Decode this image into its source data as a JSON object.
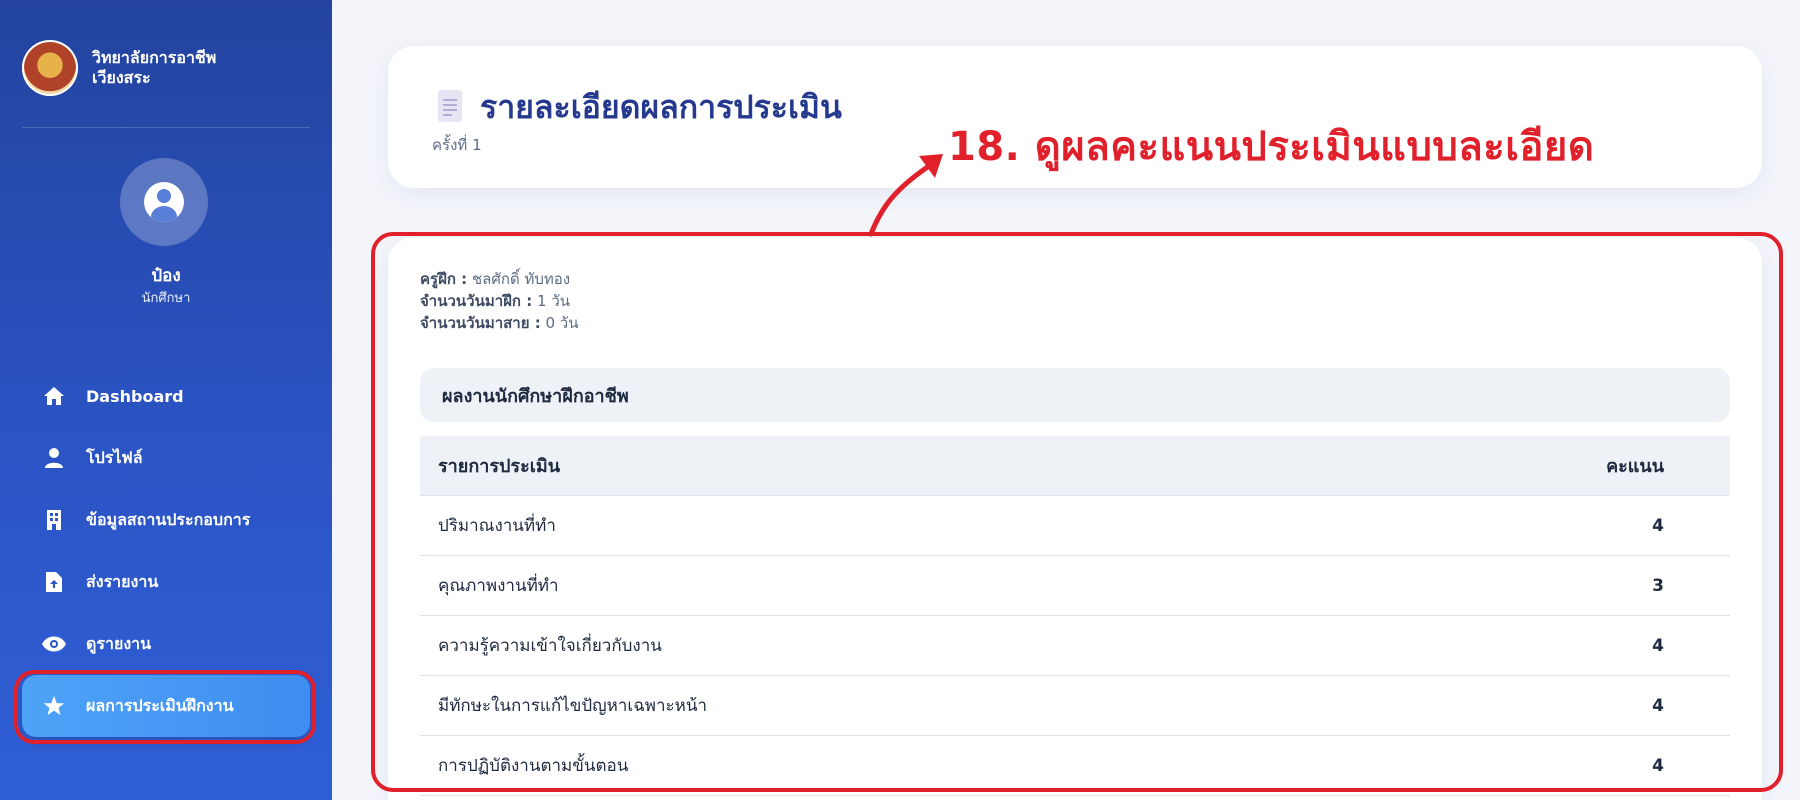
{
  "sidebar": {
    "brand": "วิทยาลัยการอาชีพเวียงสระ",
    "user_name": "ป๋อง",
    "user_role": "นักศึกษา",
    "items": [
      {
        "label": "Dashboard",
        "icon": "home-icon"
      },
      {
        "label": "โปรไฟล์",
        "icon": "user-icon"
      },
      {
        "label": "ข้อมูลสถานประกอบการ",
        "icon": "building-icon"
      },
      {
        "label": "ส่งรายงาน",
        "icon": "file-upload-icon"
      },
      {
        "label": "ดูรายงาน",
        "icon": "eye-icon"
      },
      {
        "label": "ผลการประเมินฝึกงาน",
        "icon": "star-icon",
        "active": true
      }
    ]
  },
  "header": {
    "title": "รายละเอียดผลการประเมิน",
    "subtitle": "ครั้งที่ 1"
  },
  "annotation": {
    "text": "18. ดูผลคะแนนประเมินแบบละเอียด",
    "color": "#e0212b"
  },
  "info": {
    "trainer_label": "ครูฝึก :",
    "trainer_value": "ชลศักดิ์ ทับทอง",
    "days_label": "จำนวนวันมาฝึก :",
    "days_value": "1 วัน",
    "late_label": "จำนวนวันมาสาย :",
    "late_value": "0 วัน"
  },
  "section": {
    "title": "ผลงานนักศึกษาฝึกอาชีพ"
  },
  "table": {
    "col_item": "รายการประเมิน",
    "col_score": "คะแนน",
    "rows": [
      {
        "item": "ปริมาณงานที่ทำ",
        "score": "4"
      },
      {
        "item": "คุณภาพงานที่ทำ",
        "score": "3"
      },
      {
        "item": "ความรู้ความเข้าใจเกี่ยวกับงาน",
        "score": "4"
      },
      {
        "item": "มีทักษะในการแก้ไขปัญหาเฉพาะหน้า",
        "score": "4"
      },
      {
        "item": "การปฏิบัติงานตามขั้นตอน",
        "score": "4"
      }
    ]
  }
}
